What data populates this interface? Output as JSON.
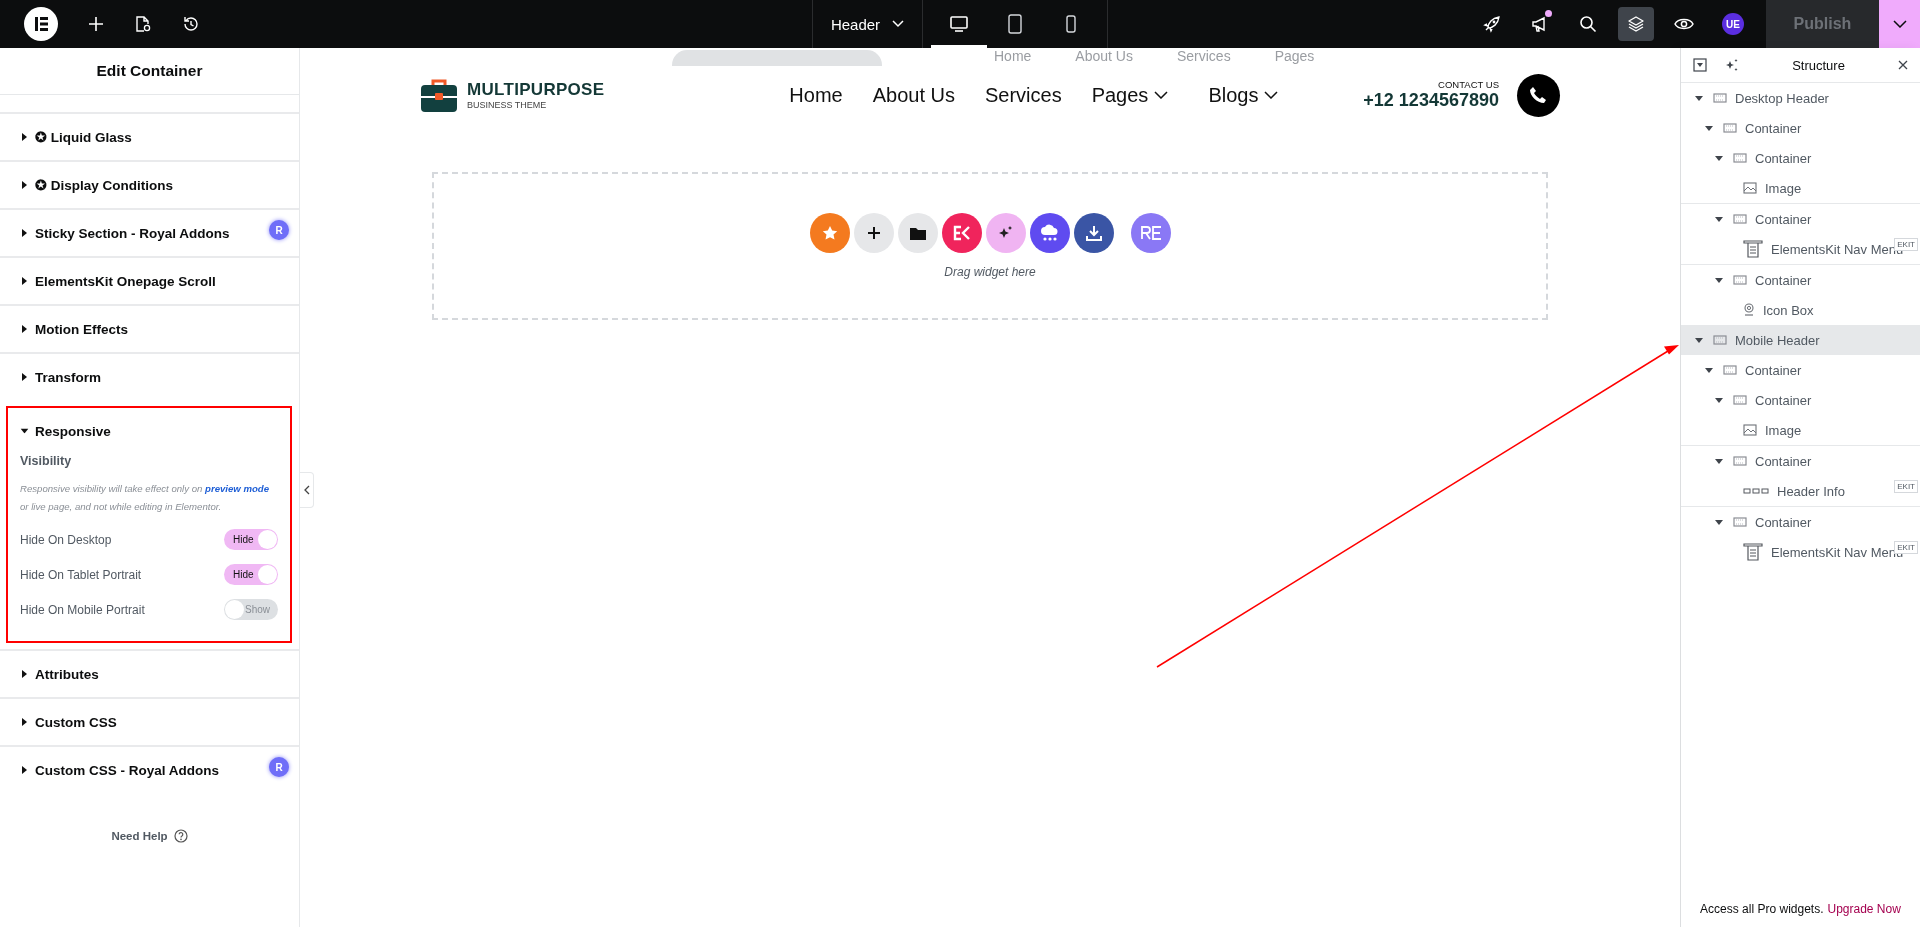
{
  "topbar": {
    "document": "Header",
    "devices": [
      {
        "kind": "desktop",
        "selected": true
      },
      {
        "kind": "tablet",
        "selected": false
      },
      {
        "kind": "mobile",
        "selected": false
      }
    ],
    "tools": [
      {
        "kind": "rocket",
        "selected": false,
        "notification": false
      },
      {
        "kind": "megaphone",
        "selected": false,
        "notification": true
      },
      {
        "kind": "search",
        "selected": false,
        "notification": false
      },
      {
        "kind": "layers",
        "selected": true,
        "notification": false
      },
      {
        "kind": "eye",
        "selected": false,
        "notification": false
      }
    ],
    "user_badge": "UE",
    "publish": {
      "label": "Publish",
      "disabled": true
    }
  },
  "panel": {
    "title": "Edit Container",
    "sections": [
      {
        "label": "✪ Liquid Glass",
        "expanded": false,
        "highlighted": false
      },
      {
        "label": "✪ Display Conditions",
        "expanded": false,
        "highlighted": false
      },
      {
        "label": "Sticky Section - Royal Addons",
        "expanded": false,
        "highlighted": false,
        "badge": "R"
      },
      {
        "label": "ElementsKit Onepage Scroll",
        "expanded": false,
        "highlighted": false
      },
      {
        "label": "Motion Effects",
        "expanded": false,
        "highlighted": false
      },
      {
        "label": "Transform",
        "expanded": false,
        "highlighted": false
      },
      {
        "label": "Responsive",
        "expanded": true,
        "highlighted": true,
        "heading": "Visibility",
        "note_before": "Responsive visibility will take effect only on",
        "note_link": "preview mode",
        "note_after": "or live page, and not while editing in Elementor.",
        "toggles": [
          {
            "label": "Hide On Desktop",
            "on": true,
            "state_text": "Hide"
          },
          {
            "label": "Hide On Tablet Portrait",
            "on": true,
            "state_text": "Hide"
          },
          {
            "label": "Hide On Mobile Portrait",
            "on": false,
            "state_text": "Show"
          }
        ]
      },
      {
        "label": "Attributes",
        "expanded": false,
        "highlighted": false
      },
      {
        "label": "Custom CSS",
        "expanded": false,
        "highlighted": false
      },
      {
        "label": "Custom CSS - Royal Addons",
        "expanded": false,
        "highlighted": false,
        "badge": "R"
      }
    ],
    "help": "Need Help"
  },
  "canvas": {
    "ghost_nav": [
      "Home",
      "About Us",
      "Services",
      "Pages"
    ],
    "logo": {
      "title": "MULTIPURPOSE",
      "subtitle": "BUSINESS THEME"
    },
    "nav": [
      {
        "label": "Home",
        "dropdown": false
      },
      {
        "label": "About Us",
        "dropdown": false
      },
      {
        "label": "Services",
        "dropdown": false
      },
      {
        "label": "Pages",
        "dropdown": true
      },
      {
        "label": "Blogs",
        "dropdown": true
      }
    ],
    "contact": {
      "label": "CONTACT US",
      "phone": "+12 1234567890"
    },
    "dropzone": {
      "buttons": [
        {
          "kind": "star",
          "color": "#f47a1f"
        },
        {
          "kind": "add",
          "color": "#e6e7e9"
        },
        {
          "kind": "folder",
          "color": "#e6e7e9"
        },
        {
          "kind": "ek",
          "color": "#f0245c"
        },
        {
          "kind": "ai",
          "color": "#f0b4f2"
        },
        {
          "kind": "cloud",
          "color": "#5f4bf0"
        },
        {
          "kind": "download",
          "color": "#3a55a5"
        },
        {
          "kind": "re",
          "color": "#8a78f5"
        }
      ],
      "hint": "Drag widget here"
    }
  },
  "structure": {
    "title": "Structure",
    "tree": [
      {
        "label": "Desktop Header",
        "kind": "container",
        "expanded": true,
        "selected": false,
        "children": [
          {
            "label": "Container",
            "kind": "container",
            "expanded": true,
            "selected": false,
            "children": [
              {
                "label": "Container",
                "kind": "container",
                "expanded": true,
                "selected": false,
                "children": [
                  {
                    "label": "Image",
                    "kind": "image",
                    "selected": false
                  }
                ]
              },
              {
                "label": "Container",
                "kind": "container",
                "expanded": true,
                "selected": false,
                "children": [
                  {
                    "label": "ElementsKit Nav Menu",
                    "kind": "nav_menu",
                    "selected": false,
                    "badge": "EKIT"
                  }
                ]
              },
              {
                "label": "Container",
                "kind": "container",
                "expanded": true,
                "selected": false,
                "children": [
                  {
                    "label": "Icon Box",
                    "kind": "icon_box",
                    "selected": false
                  }
                ]
              }
            ]
          }
        ]
      },
      {
        "label": "Mobile Header",
        "kind": "container",
        "expanded": true,
        "selected": true,
        "children": [
          {
            "label": "Container",
            "kind": "container",
            "expanded": true,
            "selected": false,
            "children": [
              {
                "label": "Container",
                "kind": "container",
                "expanded": true,
                "selected": false,
                "children": [
                  {
                    "label": "Image",
                    "kind": "image",
                    "selected": false
                  }
                ]
              },
              {
                "label": "Container",
                "kind": "container",
                "expanded": true,
                "selected": false,
                "children": [
                  {
                    "label": "Header Info",
                    "kind": "header_info",
                    "selected": false,
                    "badge": "EKIT"
                  }
                ]
              },
              {
                "label": "Container",
                "kind": "container",
                "expanded": true,
                "selected": false,
                "children": [
                  {
                    "label": "ElementsKit Nav Menu",
                    "kind": "nav_menu",
                    "selected": false,
                    "badge": "EKIT"
                  }
                ]
              }
            ]
          }
        ]
      }
    ],
    "footer_text": "Access all Pro widgets.",
    "footer_link": "Upgrade Now"
  },
  "annotations": [
    {
      "kind": "arrow"
    }
  ]
}
